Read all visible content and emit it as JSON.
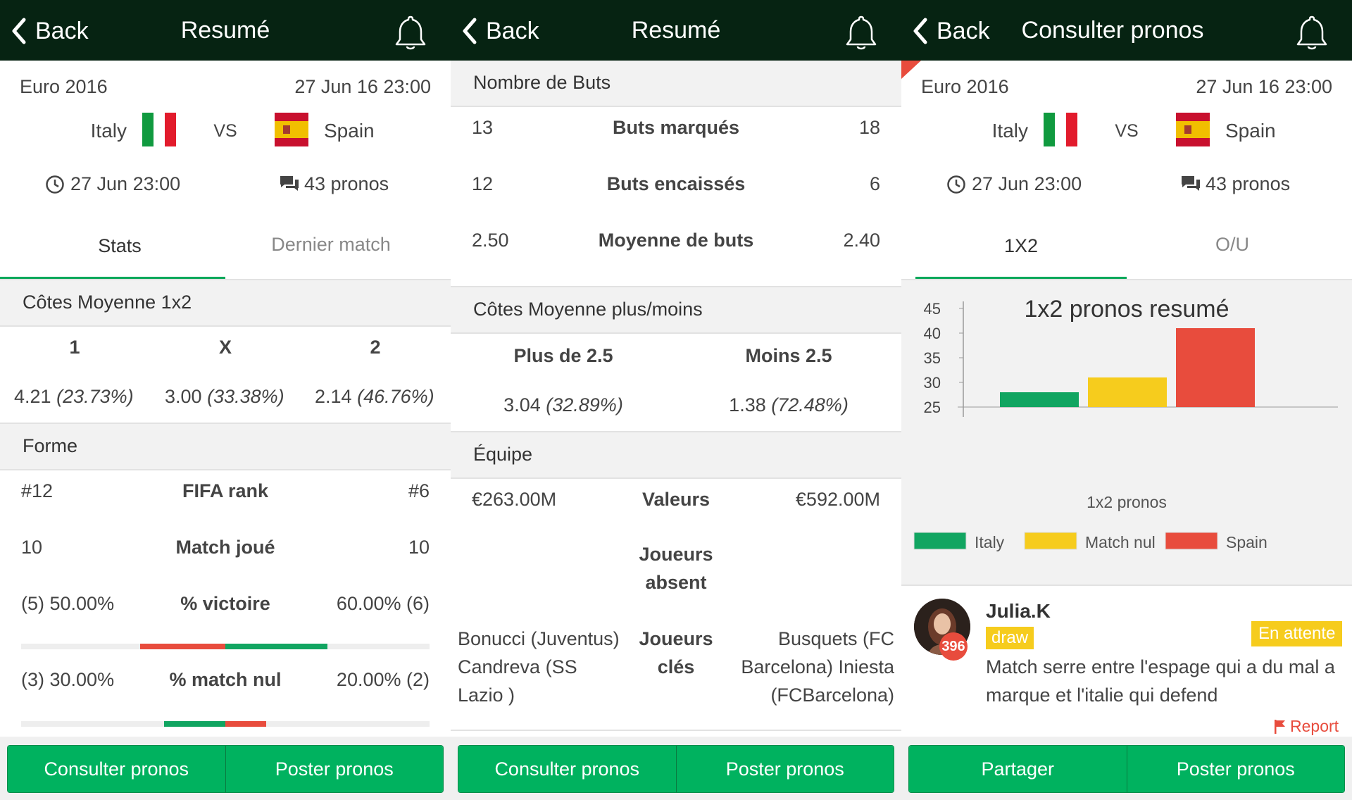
{
  "colors": {
    "header_bg": "#062312",
    "accent_green": "#00b25f",
    "italy": "#11a561",
    "draw": "#f6cc1d",
    "spain": "#e84c3d"
  },
  "panel1": {
    "header": {
      "back": "Back",
      "title": "Resumé"
    },
    "match": {
      "competition": "Euro 2016",
      "datetime": "27 Jun 16 23:00",
      "home": "Italy",
      "vs": "VS",
      "away": "Spain",
      "time": "27 Jun 23:00",
      "pronos": "43 pronos"
    },
    "tabs": {
      "stats": "Stats",
      "last": "Dernier match"
    },
    "odds": {
      "title": "Côtes Moyenne 1x2",
      "col1": "1",
      "colx": "X",
      "col2": "2",
      "v1": "4.21",
      "p1": "(23.73%)",
      "vx": "3.00",
      "px": "(33.38%)",
      "v2": "2.14",
      "p2": "(46.76%)"
    },
    "form": {
      "title": "Forme",
      "rank_label": "FIFA rank",
      "rank_home": "#12",
      "rank_away": "#6",
      "played_label": "Match joué",
      "played_home": "10",
      "played_away": "10",
      "win_label": "% victoire",
      "win_home": "(5) 50.00%",
      "win_away": "60.00% (6)",
      "win_home_frac": 0.5,
      "win_away_frac": 0.6,
      "draw_label": "% match nul",
      "draw_home": "(3) 30.00%",
      "draw_away": "20.00% (2)",
      "draw_home_frac": 0.3,
      "draw_away_frac": 0.2
    },
    "buttons": {
      "left": "Consulter pronos",
      "right": "Poster pronos"
    }
  },
  "panel2": {
    "header": {
      "back": "Back",
      "title": "Resumé"
    },
    "goals": {
      "title": "Nombre de Buts",
      "scored_label": "Buts marqués",
      "scored_home": "13",
      "scored_away": "18",
      "conceded_label": "Buts encaissés",
      "conceded_home": "12",
      "conceded_away": "6",
      "avg_label": "Moyenne de buts",
      "avg_home": "2.50",
      "avg_away": "2.40"
    },
    "ou": {
      "title": "Côtes Moyenne plus/moins",
      "plus_label": "Plus de 2.5",
      "plus_val": "3.04",
      "plus_pct": "(32.89%)",
      "minus_label": "Moins 2.5",
      "minus_val": "1.38",
      "minus_pct": "(72.48%)"
    },
    "team": {
      "title": "Équipe",
      "value_label": "Valeurs",
      "value_home": "€263.00M",
      "value_away": "€592.00M",
      "absent_label_1": "Joueurs",
      "absent_label_2": "absent",
      "key_label_1": "Joueurs",
      "key_label_2": "clés",
      "key_home_1": "Bonucci (Juventus)",
      "key_home_2": "Candreva (SS",
      "key_home_3": "Lazio )",
      "key_away_1": "Busquets (FC",
      "key_away_2": "Barcelona) Iniesta",
      "key_away_3": "(FCBarcelona)"
    },
    "buttons": {
      "left": "Consulter pronos",
      "right": "Poster pronos"
    }
  },
  "panel3": {
    "header": {
      "back": "Back",
      "title": "Consulter pronos"
    },
    "match": {
      "competition": "Euro 2016",
      "datetime": "27 Jun 16 23:00",
      "home": "Italy",
      "vs": "VS",
      "away": "Spain",
      "time": "27 Jun 23:00",
      "pronos": "43 pronos"
    },
    "tabs": {
      "one_x_two": "1X2",
      "ou": "O/U"
    },
    "chart_data": {
      "type": "bar",
      "title": "1x2 pronos resumé",
      "xlabel": "1x2 pronos",
      "ylabel": "",
      "ylim": [
        25,
        45
      ],
      "yticks": [
        "45",
        "40",
        "35",
        "30",
        "25"
      ],
      "categories": [
        "Italy",
        "Match nul",
        "Spain"
      ],
      "values": [
        28,
        31,
        41
      ],
      "colors": [
        "#11a561",
        "#f6cc1d",
        "#e84c3d"
      ],
      "legend_position": "bottom"
    },
    "comment": {
      "user": "Julia.K",
      "level": "396",
      "pick": "draw",
      "status": "En attente",
      "text_1": "Match serre entre l'espage qui a du mal a",
      "text_2": "marque et l'italie qui defend",
      "report": "Report"
    },
    "buttons": {
      "left": "Partager",
      "right": "Poster pronos"
    }
  }
}
